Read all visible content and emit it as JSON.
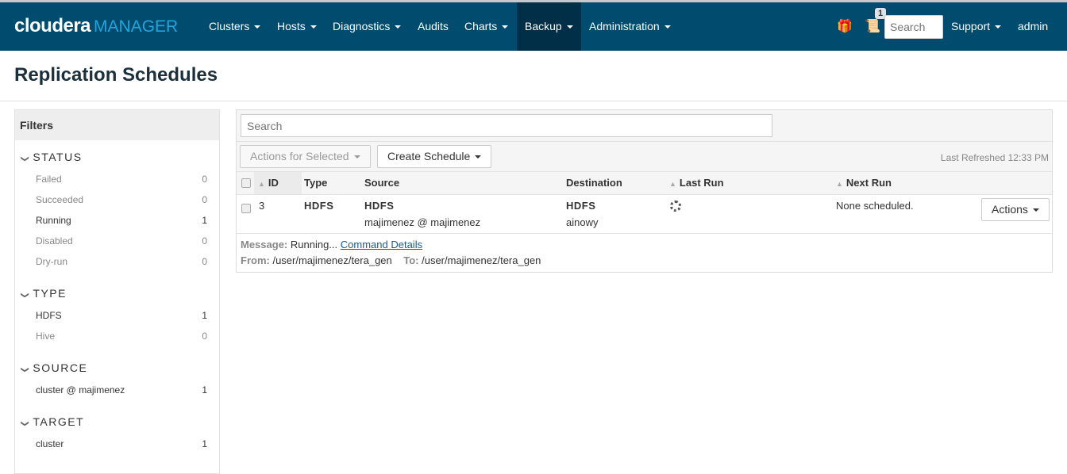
{
  "nav": {
    "logo_main": "cloudera",
    "logo_sub": "MANAGER",
    "items": [
      {
        "label": "Clusters",
        "caret": true
      },
      {
        "label": "Hosts",
        "caret": true
      },
      {
        "label": "Diagnostics",
        "caret": true
      },
      {
        "label": "Audits",
        "caret": false
      },
      {
        "label": "Charts",
        "caret": true
      },
      {
        "label": "Backup",
        "caret": true,
        "active": true
      },
      {
        "label": "Administration",
        "caret": true
      }
    ],
    "badge": "1",
    "search_placeholder": "Search",
    "support": "Support",
    "user": "admin"
  },
  "page": {
    "title": "Replication Schedules"
  },
  "filters": {
    "title": "Filters",
    "groups": [
      {
        "name": "STATUS",
        "items": [
          {
            "label": "Failed",
            "count": "0"
          },
          {
            "label": "Succeeded",
            "count": "0"
          },
          {
            "label": "Running",
            "count": "1"
          },
          {
            "label": "Disabled",
            "count": "0"
          },
          {
            "label": "Dry-run",
            "count": "0"
          }
        ]
      },
      {
        "name": "TYPE",
        "items": [
          {
            "label": "HDFS",
            "count": "1"
          },
          {
            "label": "Hive",
            "count": "0"
          }
        ]
      },
      {
        "name": "SOURCE",
        "items": [
          {
            "label": "cluster @ majimenez",
            "count": "1"
          }
        ]
      },
      {
        "name": "TARGET",
        "items": [
          {
            "label": "cluster",
            "count": "1"
          }
        ]
      }
    ]
  },
  "main": {
    "search_placeholder": "Search",
    "actions_for_selected": "Actions for Selected",
    "create_schedule": "Create Schedule",
    "last_refreshed": "Last Refreshed 12:33 PM",
    "columns": [
      "ID",
      "Type",
      "Source",
      "Destination",
      "Last Run",
      "Next Run"
    ],
    "row": {
      "id": "3",
      "type": "HDFS",
      "source": "HDFS",
      "source_sub": "majimenez @ majimenez",
      "destination": "HDFS",
      "destination_sub": "ainowy",
      "next_run": "None scheduled.",
      "actions": "Actions"
    },
    "message_label": "Message:",
    "message": "Running...",
    "command_details": "Command Details",
    "from_label": "From:",
    "from": "/user/majimenez/tera_gen",
    "to_label": "To:",
    "to": "/user/majimenez/tera_gen"
  }
}
